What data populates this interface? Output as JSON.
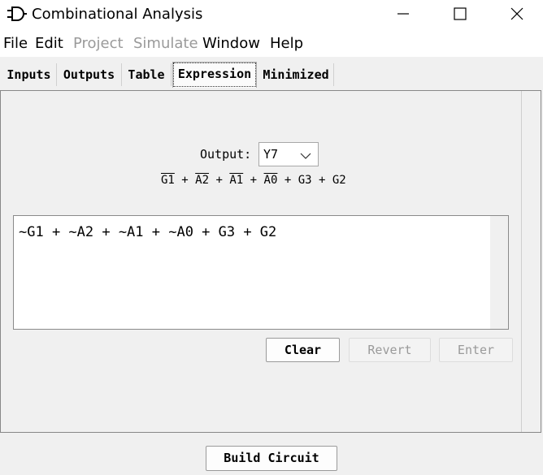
{
  "window": {
    "title": "Combinational Analysis",
    "controls": [
      "minimize",
      "maximize",
      "close"
    ]
  },
  "menu": [
    {
      "label": "File",
      "enabled": true
    },
    {
      "label": "Edit",
      "enabled": true
    },
    {
      "label": "Project",
      "enabled": false
    },
    {
      "label": "Simulate",
      "enabled": false
    },
    {
      "label": "Window",
      "enabled": true
    },
    {
      "label": "Help",
      "enabled": true
    }
  ],
  "tabs": [
    {
      "label": "Inputs"
    },
    {
      "label": "Outputs"
    },
    {
      "label": "Table"
    },
    {
      "label": "Expression",
      "active": true
    },
    {
      "label": "Minimized"
    }
  ],
  "expression": {
    "output_label": "Output:",
    "output_value": "Y7",
    "rendered_terms": [
      {
        "text": "G1",
        "negated": true
      },
      {
        "text": "A2",
        "negated": true
      },
      {
        "text": "A1",
        "negated": true
      },
      {
        "text": "A0",
        "negated": true
      },
      {
        "text": "G3",
        "negated": false
      },
      {
        "text": "G2",
        "negated": false
      }
    ],
    "operator": "+",
    "text": "~G1 + ~A2 + ~A1 + ~A0 + G3 + G2"
  },
  "buttons": {
    "clear": "Clear",
    "revert": "Revert",
    "enter": "Enter",
    "build": "Build Circuit"
  }
}
